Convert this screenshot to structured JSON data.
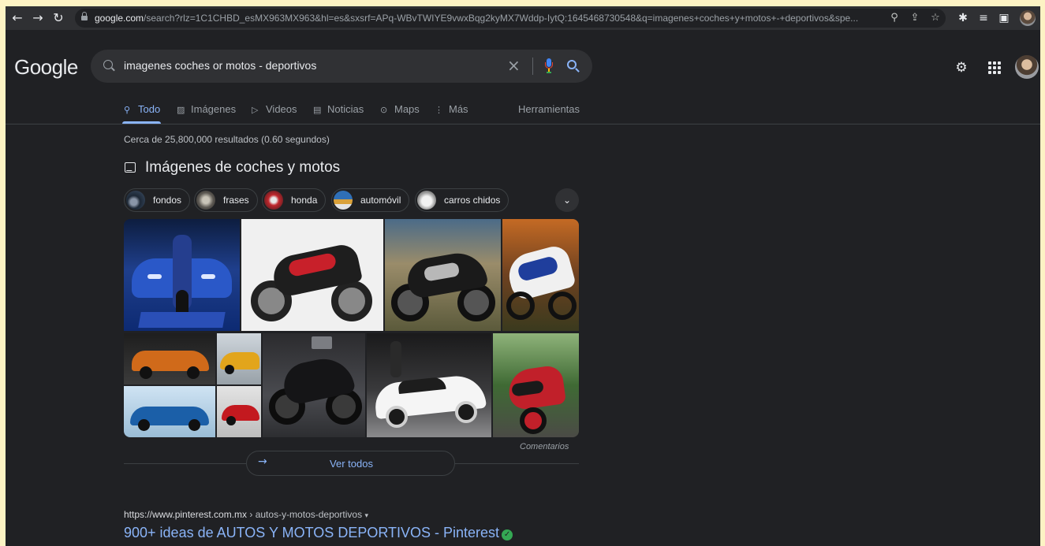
{
  "browser": {
    "url_domain": "google.com",
    "url_rest": "/search?rlz=1C1CHBD_esMX963MX963&hl=es&sxsrf=APq-WBvTWIYE9vwxBqg2kyMX7Wddp-IytQ:1645468730548&q=imagenes+coches+y+motos+-+deportivos&spe...",
    "icons": [
      "back-arrow-icon",
      "forward-arrow-icon",
      "reload-icon",
      "lock-icon",
      "location-pin-icon",
      "share-icon",
      "star-icon",
      "extensions-icon",
      "reading-list-icon",
      "side-panel-icon",
      "profile-icon"
    ]
  },
  "header": {
    "logo": "Google",
    "query": "imagenes coches or motos - deportivos",
    "clear_symbol": "×"
  },
  "tabs": [
    {
      "label": "Todo",
      "icon": "search-icon",
      "active": true
    },
    {
      "label": "Imágenes",
      "icon": "image-icon"
    },
    {
      "label": "Videos",
      "icon": "video-icon"
    },
    {
      "label": "Noticias",
      "icon": "news-icon"
    },
    {
      "label": "Maps",
      "icon": "map-pin-icon"
    },
    {
      "label": "Más",
      "icon": "more-icon"
    }
  ],
  "tools_label": "Herramientas",
  "result_stats": "Cerca de 25,800,000 resultados (0.60 segundos)",
  "images_section": {
    "heading": "Imágenes de coches y motos",
    "chips": [
      "fondos",
      "frases",
      "honda",
      "automóvil",
      "carros chidos"
    ],
    "feedback": "Comentarios",
    "view_all": "Ver todos"
  },
  "result": {
    "cite_host": "https://www.pinterest.com.mx",
    "cite_path": " › autos-y-motos-deportivos",
    "title": "900+ ideas de AUTOS Y MOTOS DEPORTIVOS - Pinterest"
  },
  "colors": {
    "background": "#202124",
    "link": "#8ab4f8",
    "text": "#e8eaed",
    "muted": "#9aa0a6",
    "verified": "#34a853"
  }
}
